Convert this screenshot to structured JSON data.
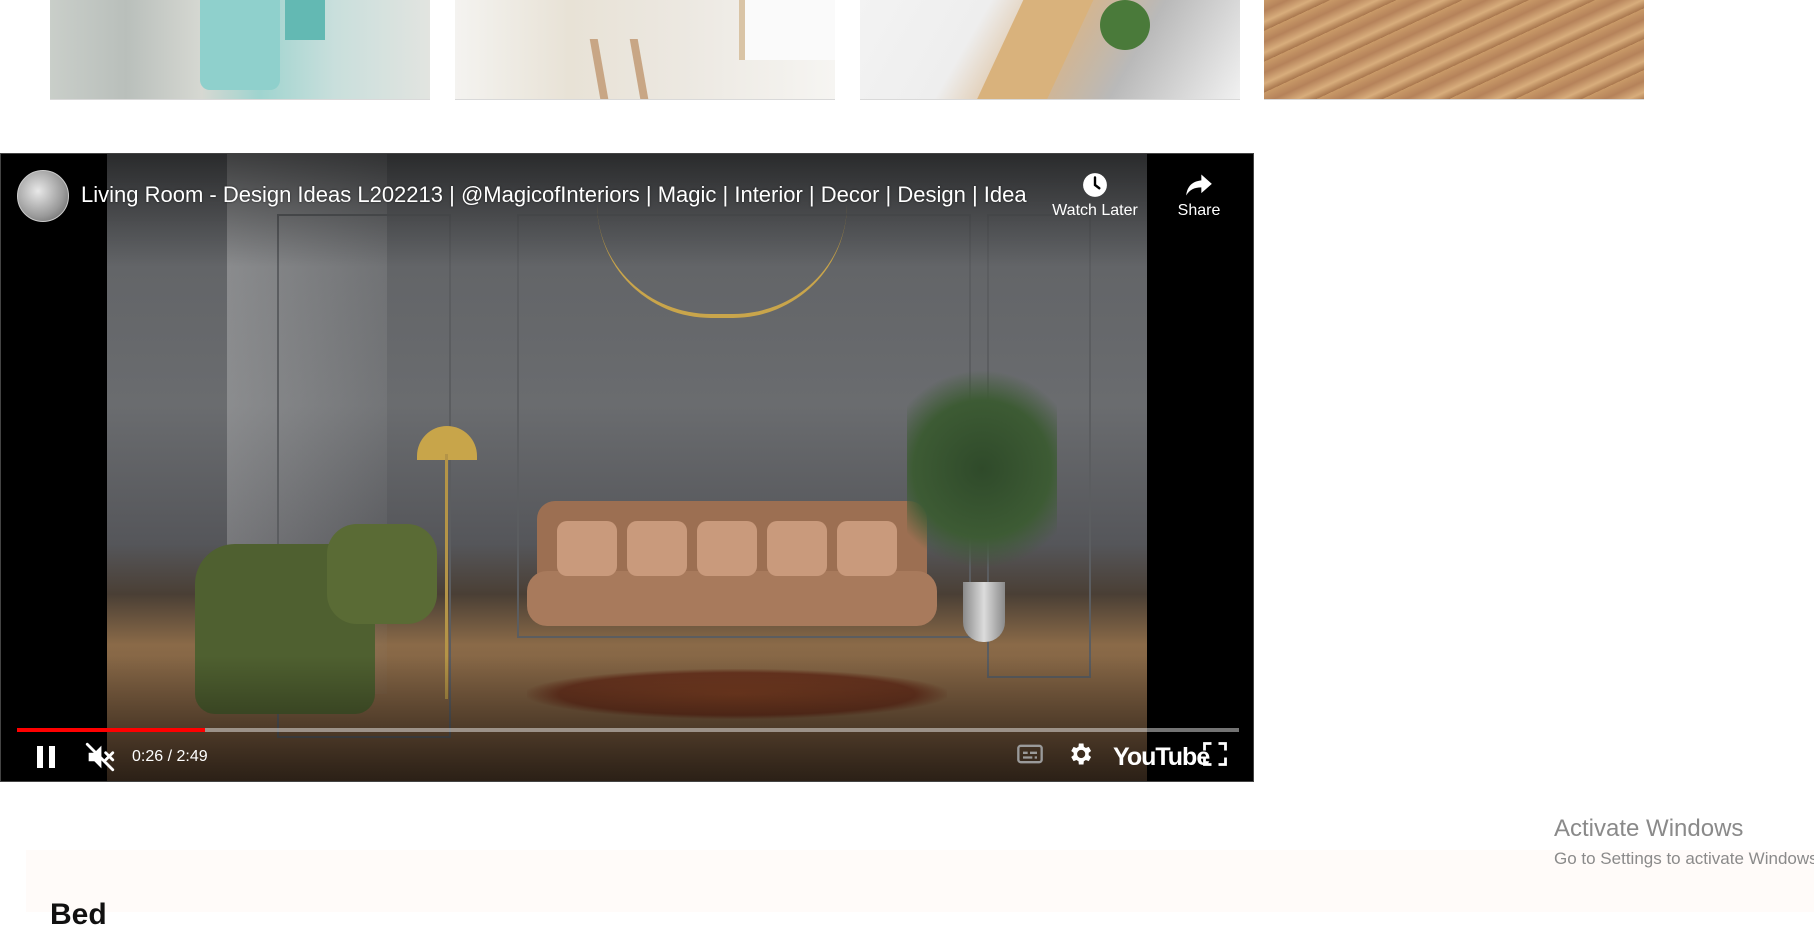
{
  "gallery": {
    "thumbnails": [
      {
        "name": "interior-thumb-1"
      },
      {
        "name": "interior-thumb-2"
      },
      {
        "name": "interior-thumb-3"
      },
      {
        "name": "interior-thumb-4"
      }
    ]
  },
  "video": {
    "title": "Living Room - Design Ideas L202213 | @MagicofInteriors | Magic | Interior | Decor | Design | Idea",
    "watch_later_label": "Watch Later",
    "share_label": "Share",
    "time_display": "0:26 / 2:49",
    "progress_fraction": 0.1538,
    "brand_label": "YouTube",
    "progress_color": "#ff0000"
  },
  "os_overlay": {
    "heading": "Activate Windows",
    "subtext": "Go to Settings to activate Windows."
  },
  "section": {
    "heading": "Bed"
  }
}
